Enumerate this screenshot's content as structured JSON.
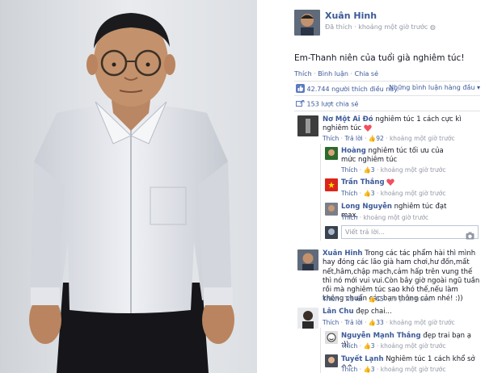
{
  "post": {
    "author": "Xuân Hinh",
    "action": "Đã thích",
    "time": "khoảng một giờ trước",
    "text": "Em-Thanh niên của tuổi già nghiêm túc!"
  },
  "actions": {
    "like": "Thích",
    "comment": "Bình luận",
    "share": "Chia sẻ"
  },
  "stats": {
    "likes": "42.744 người thích điều này.",
    "sort": "Những bình luận hàng đầu",
    "shares": "153 lượt chia sẻ"
  },
  "comments": [
    {
      "author": "Nơ Một Ai Đó",
      "text": "nghiêm túc 1 cách cực kì nghiêm túc",
      "like": "Thích",
      "reply": "Trả lời",
      "count": "92",
      "time": "khoảng một giờ trước"
    },
    {
      "author": "Hoàng",
      "text": "nghiêm túc tối ưu của mức nghiêm túc",
      "like": "Thích",
      "count": "3",
      "time": "khoảng một giờ trước"
    },
    {
      "author": "Trần Thắng",
      "like": "Thích",
      "count": "3",
      "time": "khoảng một giờ trước"
    },
    {
      "author": "Long Nguyễn",
      "text": "nghiêm túc đạt max.",
      "like": "Thích",
      "time": "khoảng một giờ trước"
    },
    {
      "author": "Xuân Hinh",
      "text": "Trong các tác phẩm hài thì mình hay đóng các lão già ham chơi,hư đốn,mất nết,hâm,chập mạch,cảm hấp trên vung thế thì nó mới vui vui.Còn bây giờ ngoài ngũ tuần rồi mà nghiêm túc sao khó thế,nếu làm không chuẩn các bạn thông cảm nhé! :))",
      "like": "Thích",
      "reply": "Trả lời",
      "count": "15",
      "time": "39 phút trước"
    },
    {
      "author": "Lân Chu",
      "text": "đẹp chai...",
      "like": "Thích",
      "reply": "Trả lời",
      "count": "33",
      "time": "khoảng một giờ trước"
    },
    {
      "author": "Nguyễn Mạnh Thắng",
      "text": "đẹp trai bạn ạ :))",
      "like": "Thích",
      "count": "3",
      "time": "khoảng một giờ trước"
    },
    {
      "author": "Tuyết Lạnh",
      "text": "Nghiêm túc 1 cách khổ sở ^^",
      "like": "Thích",
      "count": "3",
      "time": "khoảng một giờ trước"
    }
  ],
  "reply_placeholder": "Viết trả lời...",
  "colors": {
    "fb_blue": "#3b5998",
    "muted": "#9197a3",
    "background": "#000000"
  }
}
